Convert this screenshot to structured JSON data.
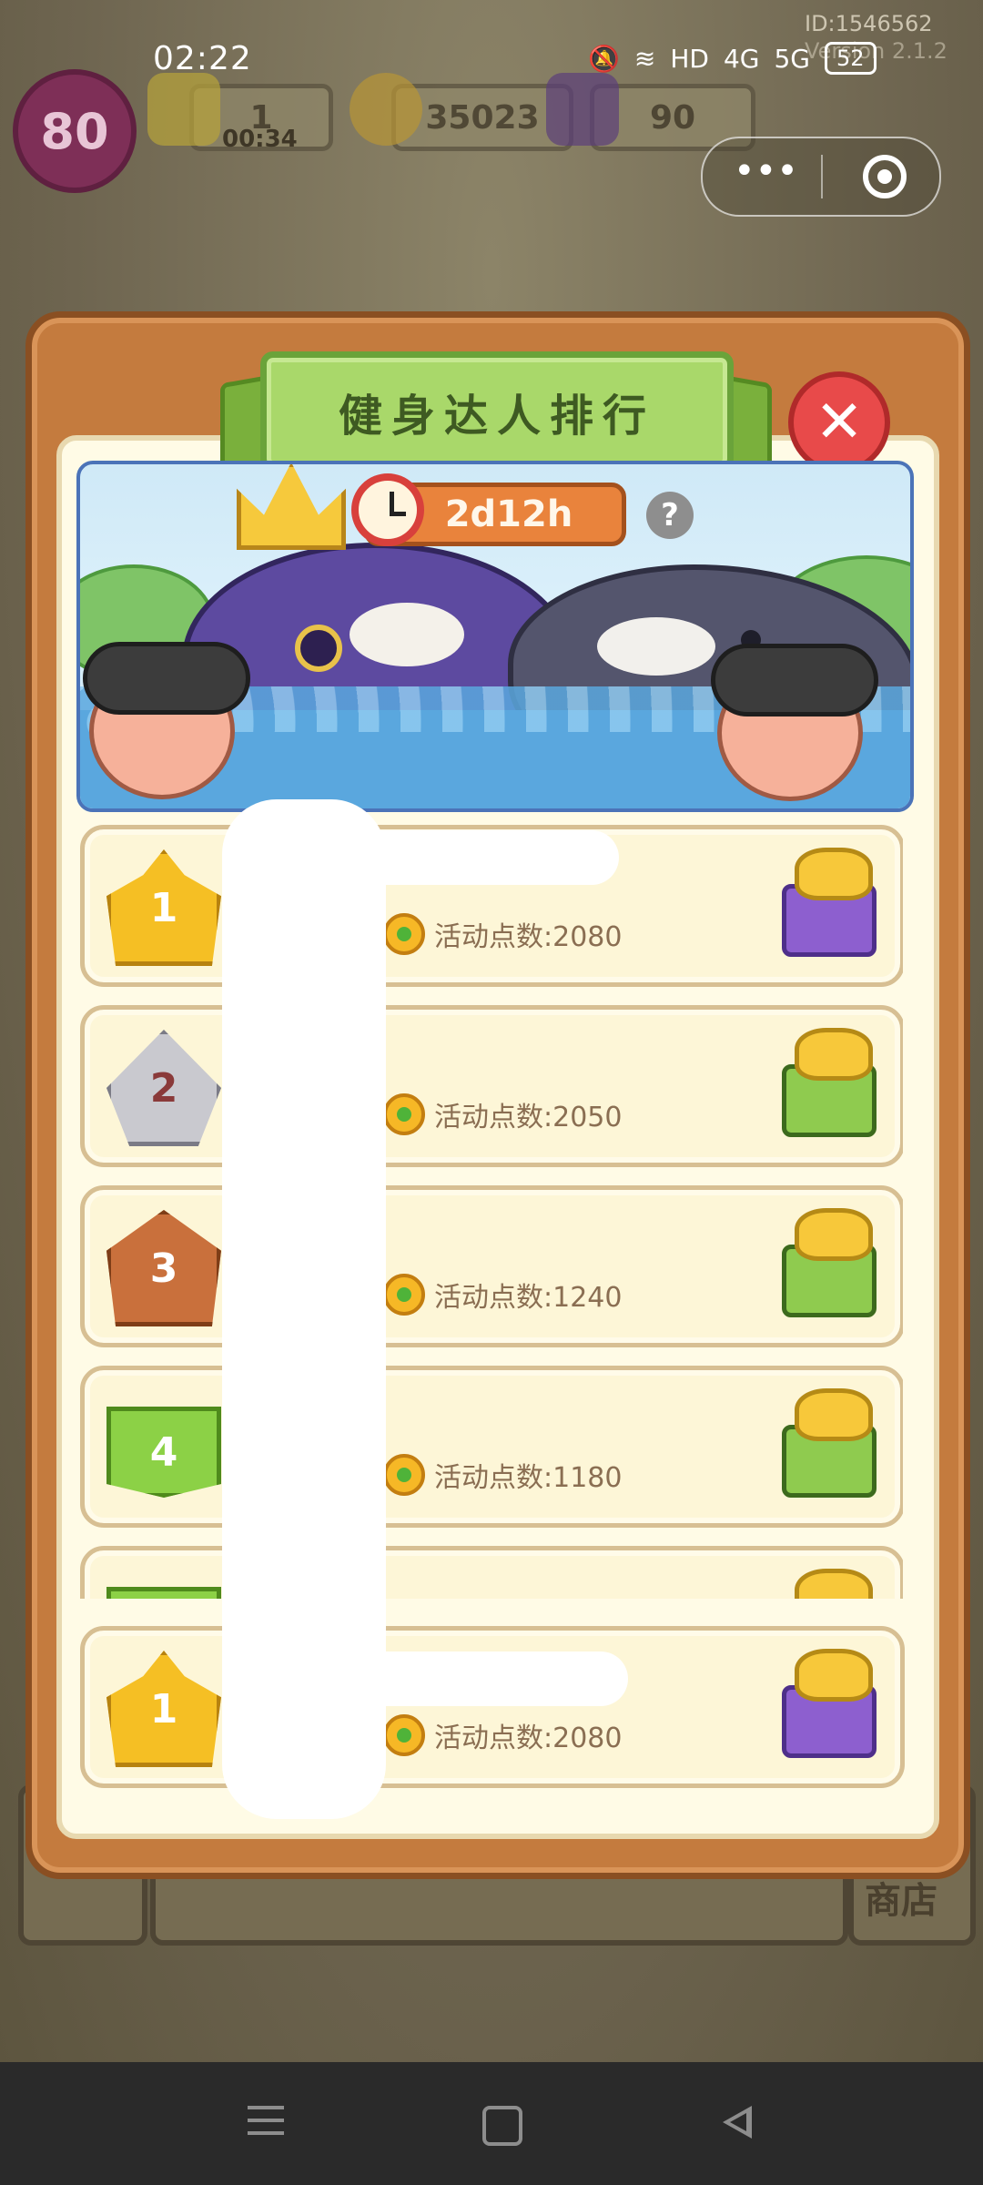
{
  "status_bar": {
    "time": "02:22",
    "battery": "52",
    "network_1": "4G",
    "network_2": "5G",
    "hd_label": "HD",
    "id_text": "ID:1546562",
    "version_text": "Version 2.1.2"
  },
  "hud": {
    "level": "80",
    "energy": "1",
    "energy_timer": "00:34",
    "coins": "35023",
    "gems": "90"
  },
  "background": {
    "shop_label": "商店"
  },
  "panel": {
    "title": "健身达人排行",
    "close_label": "✕",
    "timer": "2d12h",
    "help_label": "?"
  },
  "ranking": {
    "rows": [
      {
        "rank": "1",
        "points": "活动点数:2080",
        "reward": "purple-gift-icon"
      },
      {
        "rank": "2",
        "points": "活动点数:2050",
        "reward": "green-gift-icon"
      },
      {
        "rank": "3",
        "points": "活动点数:1240",
        "reward": "green-gift-icon"
      },
      {
        "rank": "4",
        "points": "活动点数:1180",
        "reward": "green-gift-icon"
      }
    ],
    "self_row": {
      "rank": "1",
      "points": "活动点数:2080",
      "reward": "purple-gift-icon"
    }
  },
  "colors": {
    "panel_orange": "#c47b3e",
    "ribbon_green": "#a9d86a",
    "close_red": "#e84a4a",
    "timer_orange": "#e9833c",
    "row_bg": "#fdf6d7"
  }
}
